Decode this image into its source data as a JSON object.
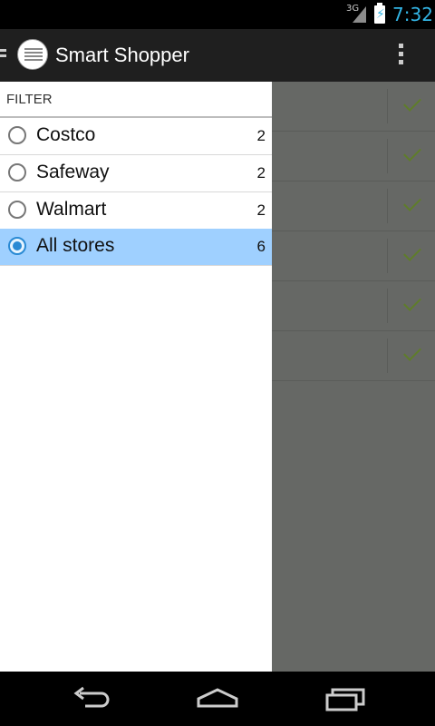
{
  "status_bar": {
    "network_label": "3G",
    "time": "7:32"
  },
  "action_bar": {
    "title": "Smart Shopper"
  },
  "drawer": {
    "header": "FILTER",
    "stores": [
      {
        "name": "Costco",
        "count": "2",
        "selected": false
      },
      {
        "name": "Safeway",
        "count": "2",
        "selected": false
      },
      {
        "name": "Walmart",
        "count": "2",
        "selected": false
      },
      {
        "name": "All stores",
        "count": "6",
        "selected": true
      }
    ]
  },
  "content": {
    "item_count_visible": 6
  },
  "colors": {
    "accent": "#33b5e5",
    "selected_row": "#9fd0ff",
    "radio_selected": "#2a8ad4",
    "dim_overlay": "#666865",
    "check": "#5f7d2a"
  },
  "icons": [
    "drawer-indicator-icon",
    "app-notepad-icon",
    "overflow-menu-icon",
    "checkmark-icon",
    "back-icon",
    "home-icon",
    "recent-apps-icon",
    "signal-icon",
    "battery-charging-icon"
  ]
}
